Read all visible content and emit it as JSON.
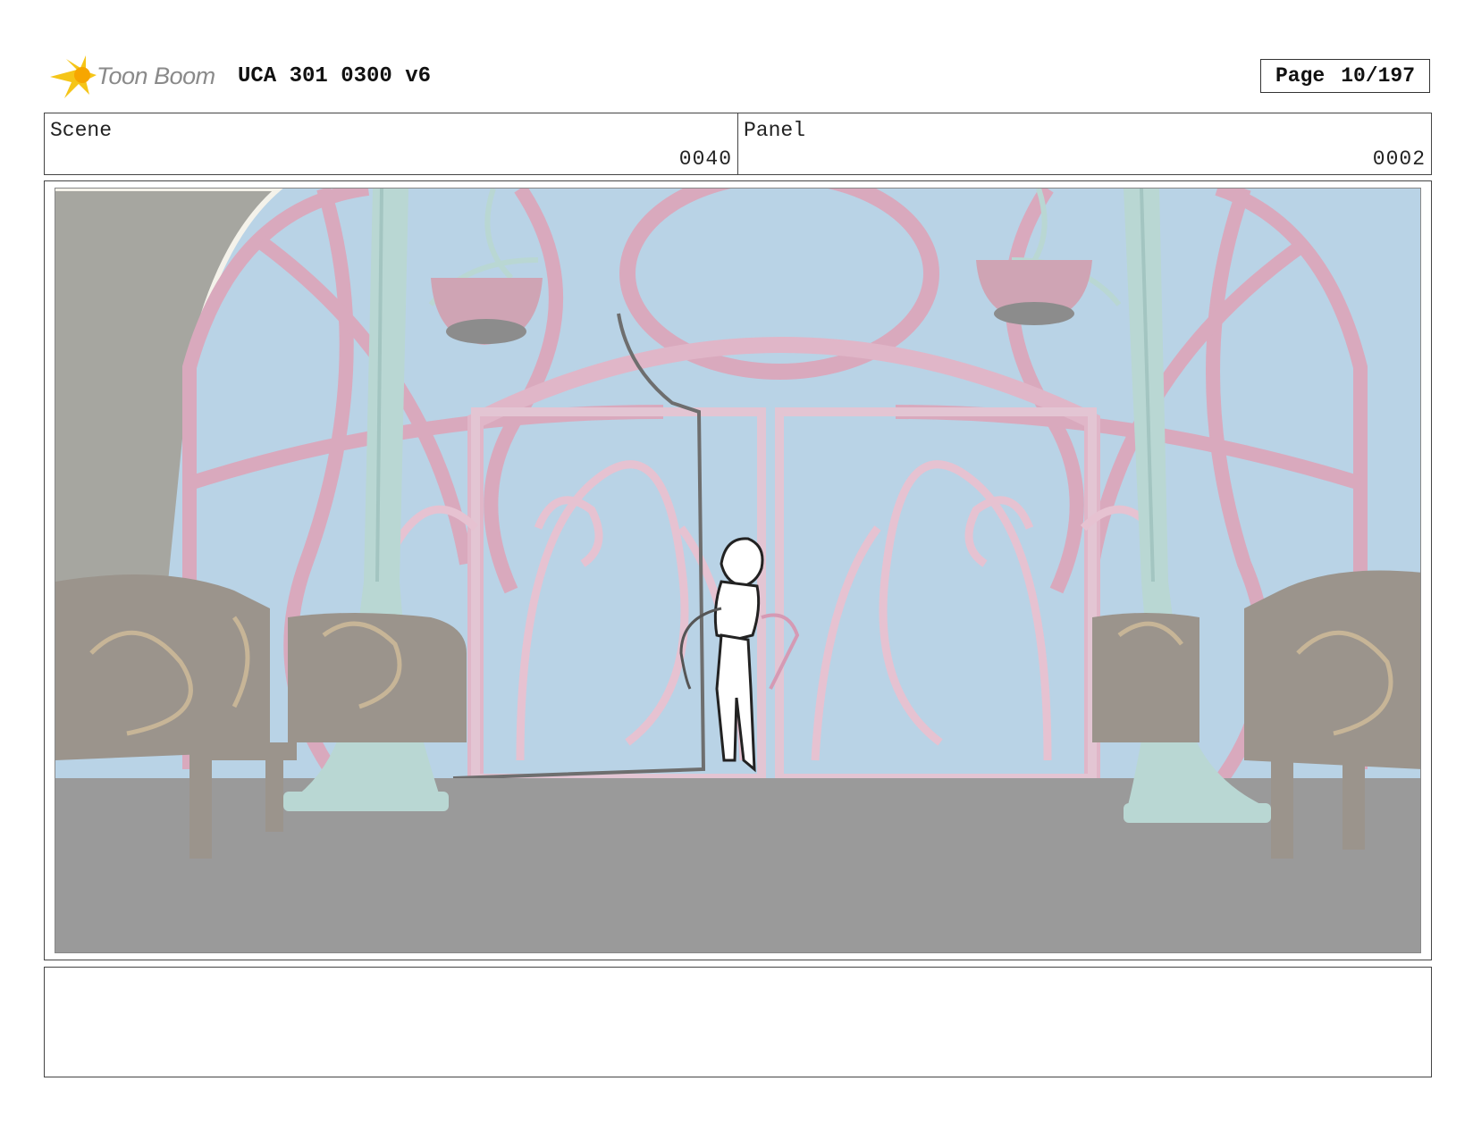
{
  "header": {
    "logo_text": "Toon Boom",
    "doc_title": "UCA 301 0300 v6",
    "page_label": "Page",
    "page_number": "10/197"
  },
  "fields": {
    "scene_label": "Scene",
    "scene_value": "0040",
    "panel_label": "Panel",
    "panel_value": "0002"
  },
  "panel": {
    "icon": "storyboard-panel-image"
  },
  "notes": {
    "text": ""
  },
  "colors": {
    "sky": "#b9d3e6",
    "ironwork": "#d9a9bd",
    "pillar": "#b9d7d3",
    "floor": "#9a9a9a",
    "wall": "#a6a6a0",
    "furniture": "#9b948c",
    "logo_yellow": "#f5c518"
  }
}
